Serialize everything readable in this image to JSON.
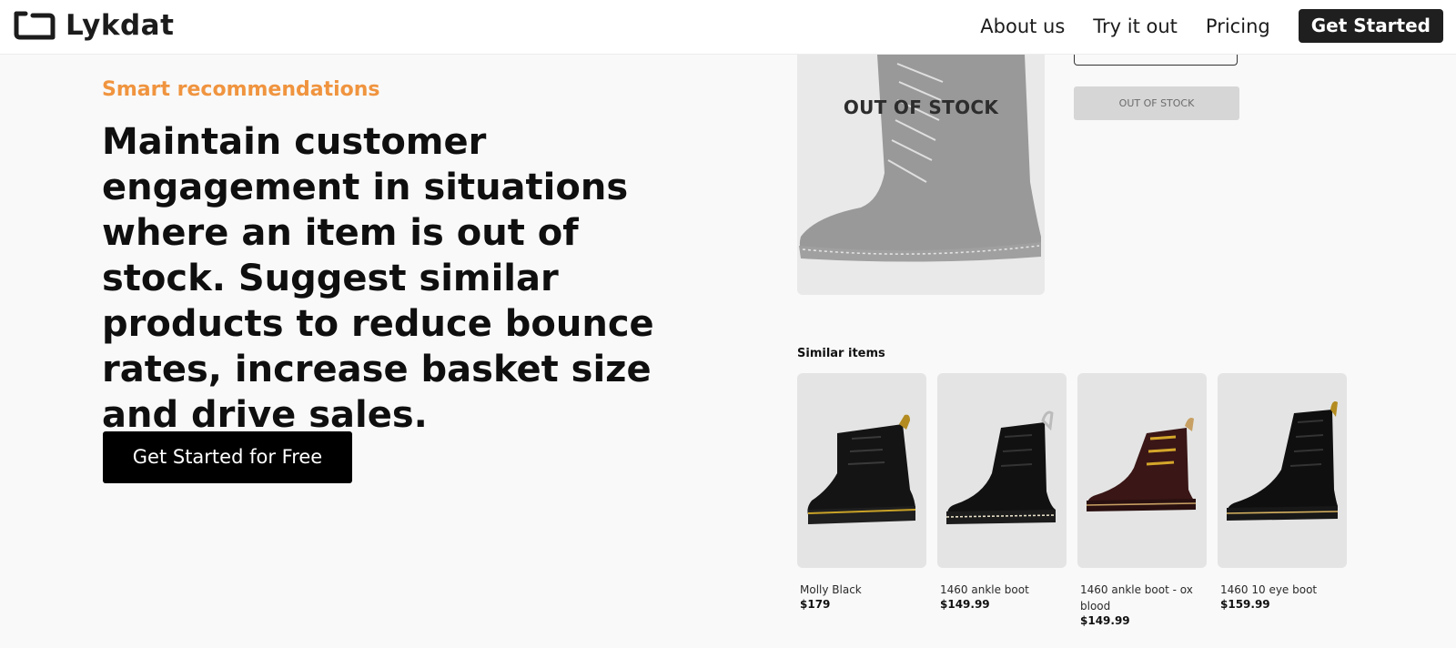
{
  "brand": {
    "name": "Lykdat",
    "logo_icon": "lykdat-logo-icon"
  },
  "nav": {
    "links": [
      "About us",
      "Try it out",
      "Pricing"
    ],
    "cta": "Get Started"
  },
  "hero": {
    "eyebrow": "Smart recommendations",
    "headline": "Maintain customer engagement in situations where an item is out of stock. Suggest similar products to reduce bounce rates, increase basket size and drive sales.",
    "cta": "Get Started for Free"
  },
  "showcase": {
    "main_product_status": "OUT OF STOCK",
    "disabled_button": "OUT OF STOCK",
    "similar_title": "Similar items",
    "items": [
      {
        "name": "Molly Black",
        "price": "$179",
        "lace_color": "#2a2a2a",
        "welt_color": "#c9a227"
      },
      {
        "name": "1460 ankle boot",
        "price": "$149.99",
        "lace_color": "#1f1f1f",
        "welt_color": "#e8e0c8"
      },
      {
        "name": "1460 ankle boot - ox blood",
        "price": "$149.99",
        "lace_color": "#d4a62a",
        "welt_color": "#c8a064"
      },
      {
        "name": "1460 10 eye boot",
        "price": "$159.99",
        "lace_color": "#1f1f1f",
        "welt_color": "#d6b160"
      }
    ]
  },
  "colors": {
    "accent": "#f0943f",
    "cta_bg": "#000000",
    "nav_cta_bg": "#1f1f1f",
    "page_bg": "#f9f9f9"
  }
}
